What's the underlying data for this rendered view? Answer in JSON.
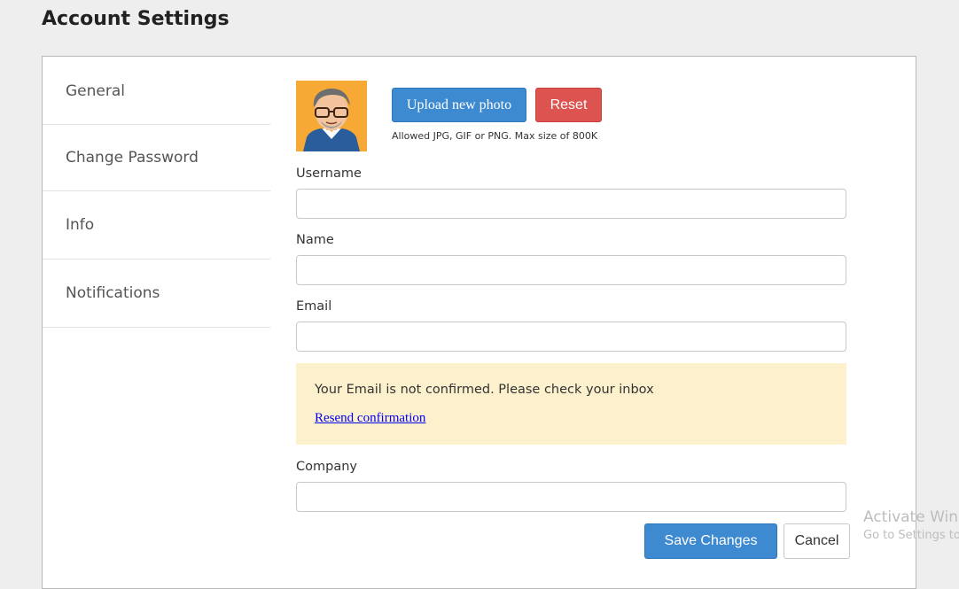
{
  "page": {
    "title": "Account Settings"
  },
  "sidebar": {
    "items": [
      {
        "label": "General"
      },
      {
        "label": "Change Password"
      },
      {
        "label": "Info"
      },
      {
        "label": "Notifications"
      }
    ]
  },
  "profile": {
    "upload_label": "Upload new photo",
    "reset_label": "Reset",
    "hint": "Allowed JPG, GIF or PNG. Max size of 800K"
  },
  "form": {
    "username": {
      "label": "Username",
      "value": ""
    },
    "name": {
      "label": "Name",
      "value": ""
    },
    "email": {
      "label": "Email",
      "value": ""
    },
    "company": {
      "label": "Company",
      "value": ""
    }
  },
  "alert": {
    "message": "Your Email is not confirmed. Please check your inbox",
    "link": "Resend confirmation"
  },
  "actions": {
    "save_label": "Save Changes",
    "cancel_label": "Cancel"
  },
  "watermark": {
    "title": "Activate Windows",
    "subtitle": "Go to Settings to activate Windows."
  },
  "colors": {
    "primary": "#3e8ad0",
    "danger": "#dc5350",
    "alert_bg": "#fdf1cd",
    "page_bg": "#eeeeee",
    "avatar_bg": "#f7a935"
  }
}
